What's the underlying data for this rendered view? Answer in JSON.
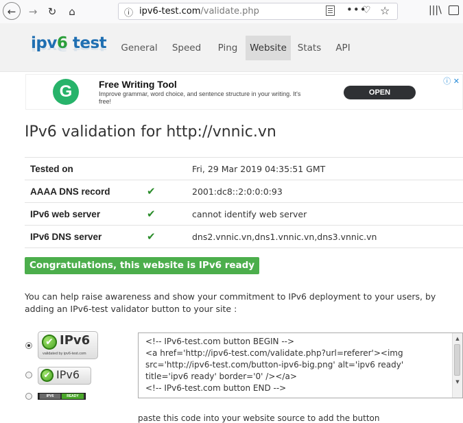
{
  "browser": {
    "url_domain": "ipv6-test.com",
    "url_path": "/validate.php",
    "menu_dots": "•••",
    "icons": [
      "back-icon",
      "forward-icon",
      "reload-icon",
      "home-icon",
      "info-icon",
      "reader-view-icon",
      "page-actions-icon",
      "pocket-icon",
      "bookmark-star-icon",
      "library-icon",
      "sidebar-icon"
    ]
  },
  "site": {
    "logo_ipv": "ipv",
    "logo_six": "6",
    "logo_test": " test",
    "nav": [
      "General",
      "Speed",
      "Ping",
      "Website",
      "Stats",
      "API"
    ],
    "active_nav": "Website"
  },
  "ad": {
    "logo_letter": "G",
    "title": "Free Writing Tool",
    "description": "Improve grammar, word choice, and sentence structure in your writing. It's free!",
    "button": "OPEN",
    "choices_icon": "ⓘ ✕"
  },
  "main": {
    "title": "IPv6 validation for http://vnnic.vn",
    "results": [
      {
        "label": "Tested on",
        "check": "",
        "value": "Fri, 29 Mar 2019 04:35:51 GMT"
      },
      {
        "label": "AAAA DNS record",
        "check": "✔",
        "value": "2001:dc8::2:0:0:0:93"
      },
      {
        "label": "IPv6 web server",
        "check": "✔",
        "value": "cannot identify web server"
      },
      {
        "label": "IPv6 DNS server",
        "check": "✔",
        "value": "dns2.vnnic.vn,dns1.vnnic.vn,dns3.vnnic.vn"
      }
    ],
    "ready_badge": "Congratulations, this website is IPv6 ready",
    "help_text": "You can help raise awareness and show your commitment to IPv6 deployment to your users, by adding an IPv6-test validator button to your site :",
    "badges": {
      "big_text": "IPv6",
      "big_sub": "validated by ipv6-test.com",
      "mid_text": "IPv6",
      "small_left": "IPV6",
      "small_right": "READY"
    },
    "code": "<!-- IPv6-test.com button BEGIN -->\n<a href='http://ipv6-test.com/validate.php?url=referer'><img src='http://ipv6-test.com/button-ipv6-big.png' alt='ipv6 ready' title='ipv6 ready' border='0' /></a>\n<!-- IPv6-test.com button END -->",
    "paste_hint": "paste this code into your website source to add the button"
  },
  "colors": {
    "logo_blue": "#1f6fb2",
    "logo_green": "#2b9f3a",
    "ready_green": "#4cae4c",
    "check_green": "#2a8c2a"
  }
}
